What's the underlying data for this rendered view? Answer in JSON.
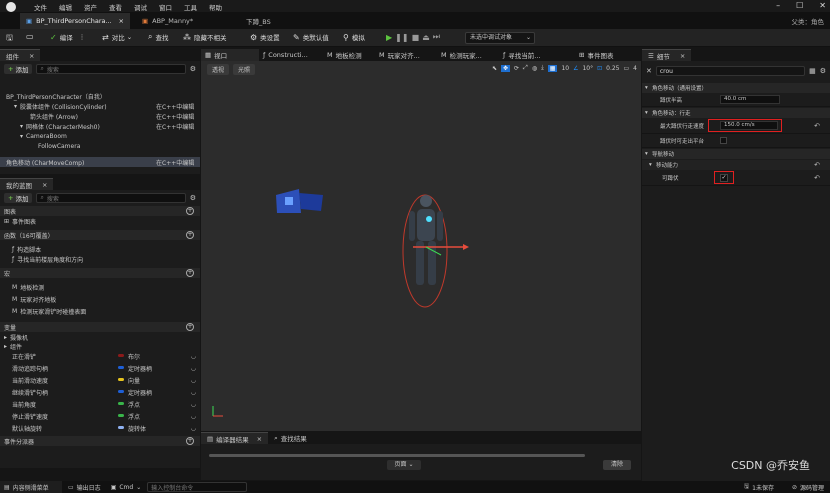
{
  "menubar": {
    "items": [
      "文件",
      "编辑",
      "资产",
      "查看",
      "调试",
      "窗口",
      "工具",
      "帮助"
    ]
  },
  "tabs": [
    {
      "label": "BP_ThirdPersonChara...",
      "close": "×"
    },
    {
      "label": "ABP_Manny*",
      "close": ""
    },
    {
      "label": "下蹲_BS",
      "close": ""
    }
  ],
  "parent_class": {
    "label": "父类：",
    "value": "角色"
  },
  "toolbar": {
    "compile": "编译",
    "diff": "对比",
    "find": "查找",
    "hide_unrelated": "隐藏不相关",
    "class_settings": "类设置",
    "class_defaults": "类默认值",
    "simulate": "模拟",
    "debug_filter": "未选中调试对象"
  },
  "components": {
    "title": "组件",
    "add": "添加",
    "search_placeholder": "搜索",
    "items": [
      {
        "label": "BP_ThirdPersonCharacter（自我）",
        "edit": ""
      },
      {
        "label": "胶囊体组件 (CollisionCylinder)",
        "edit": "在C++中编辑"
      },
      {
        "label": "箭头组件 (Arrow)",
        "edit": "在C++中编辑"
      },
      {
        "label": "网格体 (CharacterMesh0)",
        "edit": "在C++中编辑"
      },
      {
        "label": "CameraBoom",
        "edit": ""
      },
      {
        "label": "FollowCamera",
        "edit": ""
      },
      {
        "label": "角色移动 (CharMoveComp)",
        "edit": "在C++中编辑"
      }
    ]
  },
  "my_blueprint": {
    "title": "我的蓝图",
    "add": "添加",
    "search_placeholder": "搜索",
    "graphs_label": "图表",
    "event_graph": "事件图表",
    "functions_label": "函数（16可覆盖）",
    "functions": [
      "构造脚本",
      "寻找当前楼层角度和方向"
    ],
    "macros_label": "宏",
    "macros": [
      "地板检测",
      "玩家对齐地板",
      "检测玩家滑铲时碰撞表面"
    ],
    "variables_label": "变量",
    "var_groups": [
      "摄像机",
      "组件"
    ],
    "variables": [
      {
        "name": "正在滑铲",
        "type": "布尔",
        "color": "#8c1a1a"
      },
      {
        "name": "滑动追踪句柄",
        "type": "定时器柄",
        "color": "#1e5fd6"
      },
      {
        "name": "当前滑动速度",
        "type": "向量",
        "color": "#e6c31e"
      },
      {
        "name": "继续滑铲句柄",
        "type": "定时器柄",
        "color": "#1e5fd6"
      },
      {
        "name": "当前角度",
        "type": "浮点",
        "color": "#39b54a"
      },
      {
        "name": "停止滑铲速度",
        "type": "浮点",
        "color": "#39b54a"
      },
      {
        "name": "默认轴旋转",
        "type": "旋转体",
        "color": "#8fb1f0"
      }
    ],
    "event_dispatchers_label": "事件分派器"
  },
  "viewport": {
    "tabs": [
      "视口",
      "Constructi...",
      "地板检测",
      "玩家对齐...",
      "检测玩家...",
      "寻找当前...",
      "事件图表"
    ],
    "perspective": "透视",
    "lit": "光照",
    "grid": "10",
    "angle": "10°",
    "scale": "0.25",
    "cam": "4"
  },
  "compiler": {
    "tab_results": "编译器结果",
    "tab_find": "查找结果",
    "page_label": "页面",
    "clear": "清除"
  },
  "details": {
    "title": "细节",
    "search_value": "crou",
    "sections": [
      {
        "name": "角色移动（通用设置）",
        "rows": [
          {
            "label": "蹲伏半高",
            "value": "40.0 cm"
          }
        ]
      },
      {
        "name": "角色移动：行走",
        "rows": [
          {
            "label": "最大蹲伏行走速度",
            "value": "150.0 cm/s"
          },
          {
            "label": "蹲伏时可走出平台",
            "value": ""
          }
        ]
      },
      {
        "name": "导航移动",
        "rows": []
      },
      {
        "name": "移动能力",
        "rows": [
          {
            "label": "可蹲伏",
            "value": "✓"
          }
        ]
      }
    ]
  },
  "bottom": {
    "content_drawer": "内容侧滑菜单",
    "output_log": "输出日志",
    "cmd": "Cmd",
    "console_placeholder": "输入控制台命令",
    "unsaved": "1未保存",
    "source_control": "源码管理"
  },
  "watermark": "CSDN @乔安鱼",
  "colors": {
    "highlight": "#e02020",
    "accent_green": "#6fbd4a",
    "play_green": "#5cc43f"
  }
}
